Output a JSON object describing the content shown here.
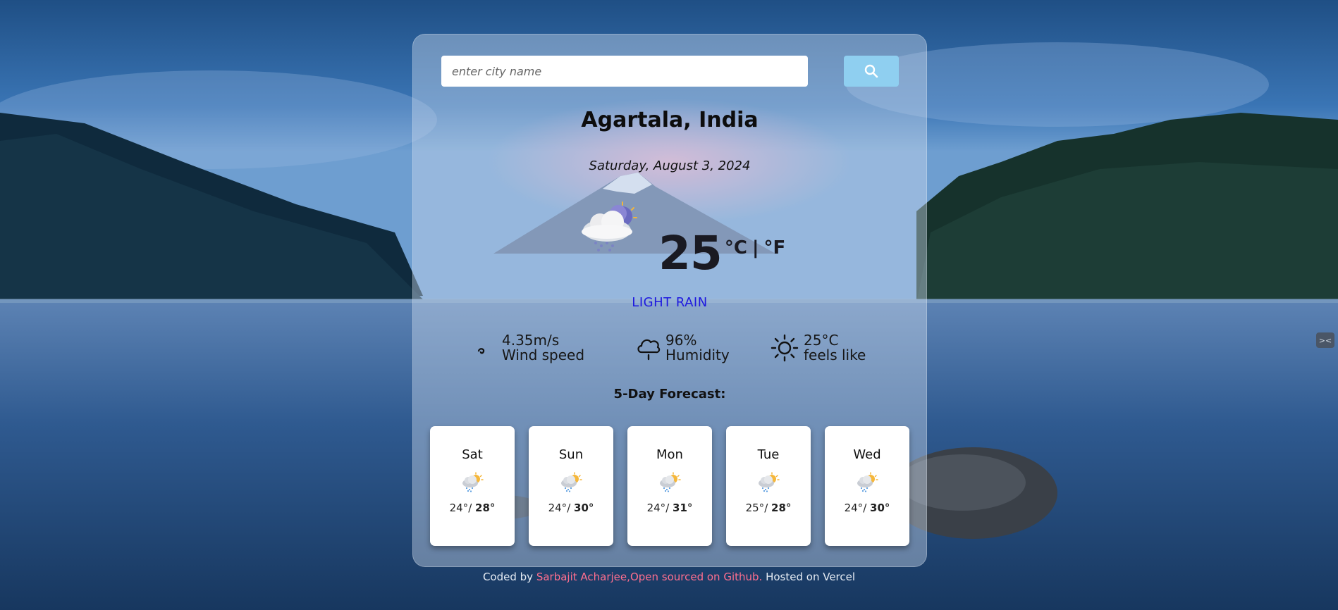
{
  "search": {
    "placeholder": "enter city name",
    "value": ""
  },
  "location": {
    "city": "Agartala, India",
    "date": "Saturday, August 3, 2024"
  },
  "current": {
    "temperature": "25",
    "unit_celsius": "°C",
    "unit_separator": "|",
    "unit_fahrenheit": "°F",
    "condition": "LIGHT RAIN",
    "icon": "cloud-moon-rain-icon"
  },
  "details": {
    "wind": {
      "value": "4.35m/s",
      "label": "Wind speed",
      "icon": "wind-icon"
    },
    "humidity": {
      "value": "96%",
      "label": "Humidity",
      "icon": "humidity-cloud-icon"
    },
    "feels_like": {
      "value": "25°C",
      "label": "feels like",
      "icon": "sun-icon"
    }
  },
  "forecast": {
    "title": "5-Day Forecast:",
    "days": [
      {
        "day": "Sat",
        "min": "24°",
        "sep": "/",
        "max": "28°",
        "icon": "sun-cloud-rain-icon"
      },
      {
        "day": "Sun",
        "min": "24°",
        "sep": "/",
        "max": "30°",
        "icon": "sun-cloud-rain-icon"
      },
      {
        "day": "Mon",
        "min": "24°",
        "sep": "/",
        "max": "31°",
        "icon": "sun-cloud-rain-icon"
      },
      {
        "day": "Tue",
        "min": "25°",
        "sep": "/",
        "max": "28°",
        "icon": "sun-cloud-rain-icon"
      },
      {
        "day": "Wed",
        "min": "24°",
        "sep": "/",
        "max": "30°",
        "icon": "sun-cloud-rain-icon"
      }
    ]
  },
  "footer": {
    "prefix": "Coded by",
    "author": "Sarbajit Acharjee",
    "comma": ",",
    "github": "Open sourced on Github.",
    "hosted": "Hosted on Vercel"
  },
  "colors": {
    "condition": "#1d18e0",
    "link": "#ff6f8f",
    "search_button": "#8fcff0"
  }
}
